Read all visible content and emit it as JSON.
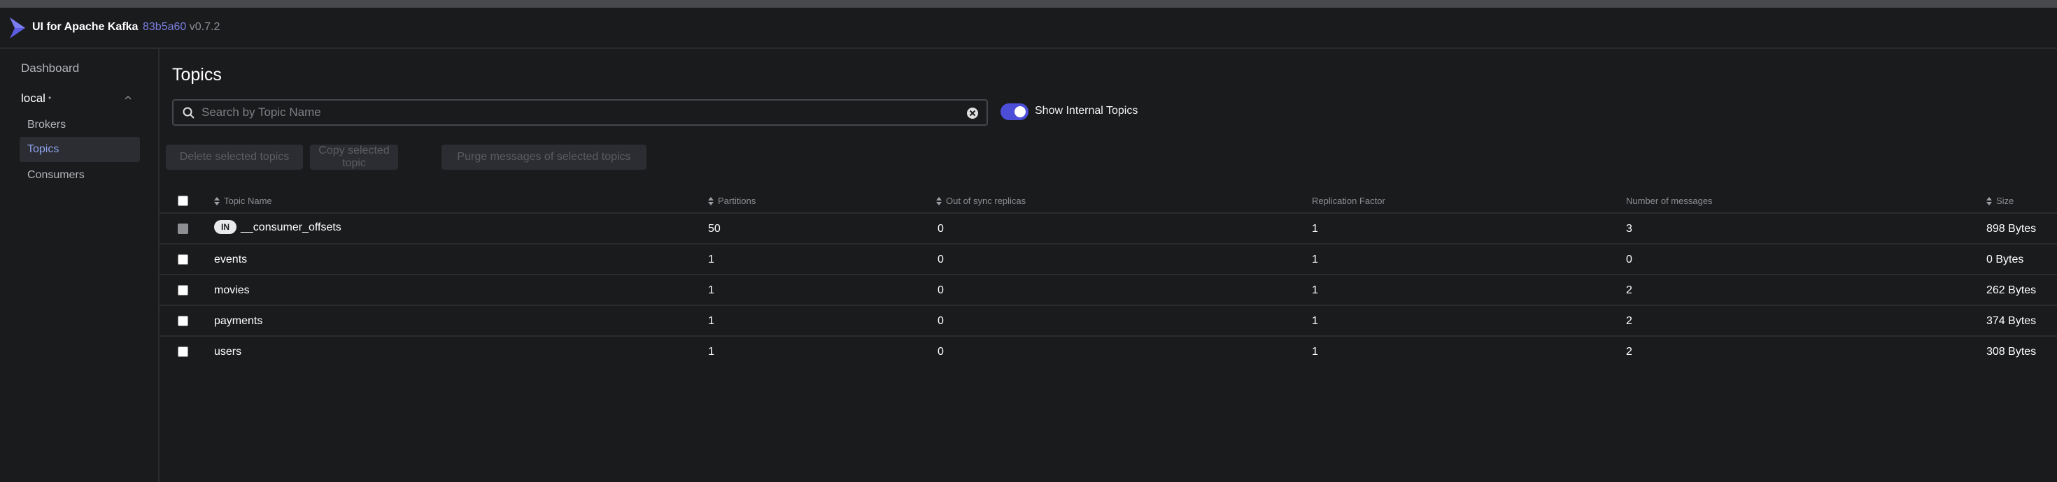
{
  "header": {
    "app_title": "UI for Apache Kafka",
    "version_hash": "83b5a60",
    "version_tag": "v0.7.2"
  },
  "sidebar": {
    "dashboard": "Dashboard",
    "cluster": "local",
    "cluster_status": "•",
    "items": [
      {
        "label": "Brokers",
        "active": false
      },
      {
        "label": "Topics",
        "active": true
      },
      {
        "label": "Consumers",
        "active": false
      }
    ]
  },
  "main": {
    "title": "Topics",
    "search_placeholder": "Search by Topic Name",
    "search_value": "",
    "toggle_label": "Show Internal Topics",
    "toggle_on": true,
    "buttons": {
      "delete": "Delete selected topics",
      "copy": "Copy selected topic",
      "purge": "Purge messages of selected topics"
    }
  },
  "table": {
    "headers": {
      "name": "Topic Name",
      "partitions": "Partitions",
      "oos": "Out of sync replicas",
      "rf": "Replication Factor",
      "messages": "Number of messages",
      "size": "Size"
    },
    "internal_badge": "IN",
    "rows": [
      {
        "name": "__consumer_offsets",
        "partitions": "50",
        "oos": "0",
        "rf": "1",
        "messages": "3",
        "size": "898 Bytes"
      },
      {
        "name": "events",
        "partitions": "1",
        "oos": "0",
        "rf": "1",
        "messages": "0",
        "size": "0 Bytes"
      },
      {
        "name": "movies",
        "partitions": "1",
        "oos": "0",
        "rf": "1",
        "messages": "2",
        "size": "262 Bytes"
      },
      {
        "name": "payments",
        "partitions": "1",
        "oos": "0",
        "rf": "1",
        "messages": "2",
        "size": "374 Bytes"
      },
      {
        "name": "users",
        "partitions": "1",
        "oos": "0",
        "rf": "1",
        "messages": "2",
        "size": "308 Bytes"
      }
    ]
  },
  "colors": {
    "accent": "#4c4ed8",
    "background": "#1a1b1d",
    "active_nav_text": "#8ea0e8"
  }
}
